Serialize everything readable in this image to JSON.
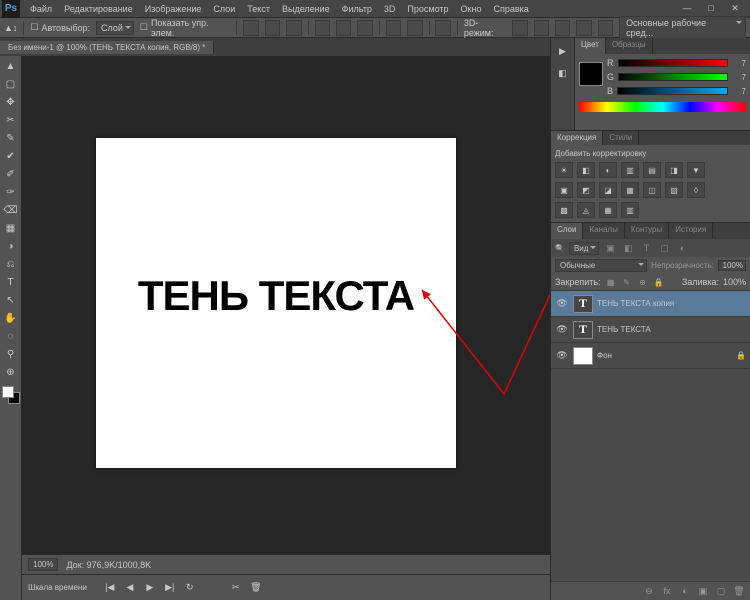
{
  "app": {
    "logo_text": "Ps"
  },
  "menu": [
    "Файл",
    "Редактирование",
    "Изображение",
    "Слои",
    "Текст",
    "Выделение",
    "Фильтр",
    "3D",
    "Просмотр",
    "Окно",
    "Справка"
  ],
  "win_controls": [
    "—",
    "□",
    "✕"
  ],
  "options": {
    "auto_select_label": "Автовыбор:",
    "auto_select_value": "Слой",
    "show_controls_label": "Показать упр. элем.",
    "mode_3d": "3D-режим:"
  },
  "workspace": "Основные рабочие сред...",
  "doc_tab": "Без имени-1 @ 100% (ТЕНЬ ТЕКСТА копия, RGB/8) *",
  "tools": [
    "▲",
    "▢",
    "✥",
    "✂",
    "✎",
    "✔",
    "✐",
    "✑",
    "⌫",
    "▦",
    "◑",
    "⎌",
    "T",
    "↖",
    "✋",
    "◌",
    "⚲",
    "⊕"
  ],
  "canvas_text": "ТЕНЬ ТЕКСТА",
  "status": {
    "zoom": "100%",
    "docinfo": "Док: 976,9K/1000,8K"
  },
  "timeline": {
    "title": "Шкала времени",
    "controls": [
      "|◀",
      "◀",
      "▶",
      "▶|",
      "↻",
      "✂",
      "🗑"
    ]
  },
  "color_panel": {
    "tabs": [
      "Цвет",
      "Образцы"
    ],
    "channels": [
      {
        "l": "R",
        "v": "7"
      },
      {
        "l": "G",
        "v": "7"
      },
      {
        "l": "B",
        "v": "7"
      }
    ]
  },
  "adj_panel": {
    "tabs": [
      "Коррекция",
      "Стили"
    ],
    "title": "Добавить корректировку",
    "icons": [
      "☀",
      "◧",
      "◐",
      "▥",
      "▤",
      "◨",
      "▣",
      "◩",
      "◪",
      "▦",
      "◫",
      "▨",
      "▩",
      "◬",
      "▼",
      "◊"
    ]
  },
  "layers_panel": {
    "tabs": [
      "Слои",
      "Каналы",
      "Контуры",
      "История"
    ],
    "filter": "Вид",
    "filter_icons": [
      "▣",
      "◧",
      "T",
      "▢",
      "◐"
    ],
    "blend": "Обычные",
    "opacity_label": "Непрозрачность:",
    "opacity": "100%",
    "lock_label": "Закрепить:",
    "lock_icons": [
      "▦",
      "✎",
      "⊕",
      "🔒"
    ],
    "fill_label": "Заливка:",
    "fill": "100%",
    "layers": [
      {
        "name": "ТЕНЬ ТЕКСТА копия",
        "type": "T",
        "sel": true
      },
      {
        "name": "ТЕНЬ ТЕКСТА",
        "type": "T",
        "sel": false
      },
      {
        "name": "Фон",
        "type": "bg",
        "sel": false,
        "locked": true
      }
    ],
    "bottom_icons": [
      "⊖",
      "fx",
      "◐",
      "▣",
      "▢",
      "🗑"
    ]
  }
}
